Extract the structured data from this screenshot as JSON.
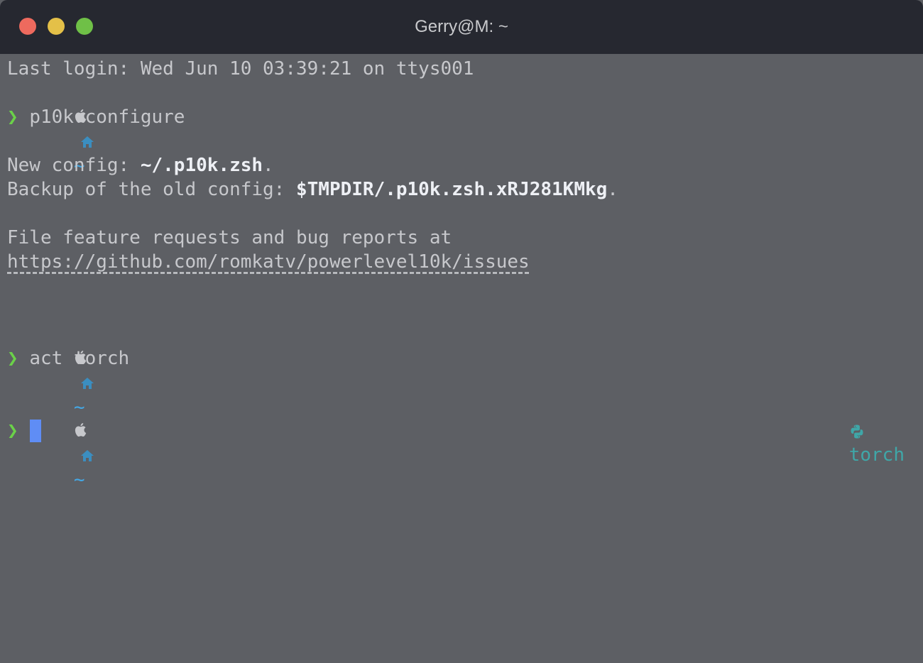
{
  "window": {
    "title": "Gerry@M: ~",
    "colors": {
      "titlebar": "#262830",
      "background": "#5d5f64",
      "close": "#ee6a5e",
      "minimize": "#e4c048",
      "maximize": "#6fc047",
      "prompt_chevron": "#6bd149",
      "cursor": "#5f8df5",
      "env_badge": "#3fa7a8"
    }
  },
  "terminal": {
    "last_login": "Last login: Wed Jun 10 03:39:21 on ttys001",
    "prompt": {
      "os_icon": "apple-icon",
      "dir_icon": "home-icon",
      "dir": "~",
      "chevron": "❯"
    },
    "cmd1": "p10k configure",
    "new_config_label": "New config: ",
    "new_config_path": "~/.p10k.zsh",
    "new_config_end": ".",
    "backup_label": "Backup of the old config: ",
    "backup_path": "$TMPDIR/.p10k.zsh.xRJ281KMkg",
    "backup_end": ".",
    "feature_text": "File feature requests and bug reports at",
    "issues_url": "https://github.com/romkatv/powerlevel10k/issues",
    "cmd2": "act torch",
    "env": {
      "icon": "python-icon",
      "name": "torch"
    }
  }
}
